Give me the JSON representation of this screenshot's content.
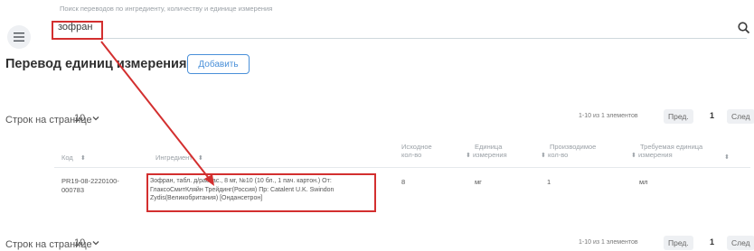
{
  "search": {
    "hint": "Поиск переводов по ингредиенту, количеству и единице измерения",
    "value": "зофран"
  },
  "page": {
    "title": "Перевод единиц измерения",
    "add_label": "Добавить"
  },
  "pagination_top": {
    "rows_label": "Строк на странице",
    "rows_value": "10",
    "info": "1-10 из 1 элементов",
    "prev": "Пред.",
    "current": "1",
    "next": "След"
  },
  "table": {
    "headers": {
      "code": "Код",
      "ingredient": "Ингредиент",
      "src_qty_1": "Исходное",
      "src_qty_2": "кол-во",
      "unit_1": "Единица",
      "unit_2": "измерения",
      "prod_qty_1": "Производимое",
      "prod_qty_2": "кол-во",
      "req_unit_1": "Требуемая единица",
      "req_unit_2": "измерения"
    },
    "row": {
      "code_1": "PR19-08-2220100-",
      "code_2": "000783",
      "ingr_1": "Зофран, табл. д/рассас., 8 мг, №10 (10 бл., 1 пач. картон.) От:",
      "ingr_2": "ГлаксоСмитКляйн Трейдинг(Россия) Пр: Catalent U.K. Swindon",
      "ingr_3": "Zydis(Великобритания) [Ондансетрон]",
      "src_qty": "8",
      "unit": "мг",
      "prod_qty": "1",
      "req_unit": "мл"
    }
  },
  "pagination_bottom": {
    "rows_label": "Строк на странице",
    "rows_value": "10",
    "info": "1-10 из 1 элементов",
    "prev": "Пред.",
    "current": "1",
    "next": "След"
  },
  "colors": {
    "accent": "#4a90d9",
    "highlight": "#d32f2f"
  },
  "icons": [
    "menu-icon",
    "search-icon",
    "chevron-down-icon",
    "sort-icon",
    "arrow-annotation"
  ]
}
